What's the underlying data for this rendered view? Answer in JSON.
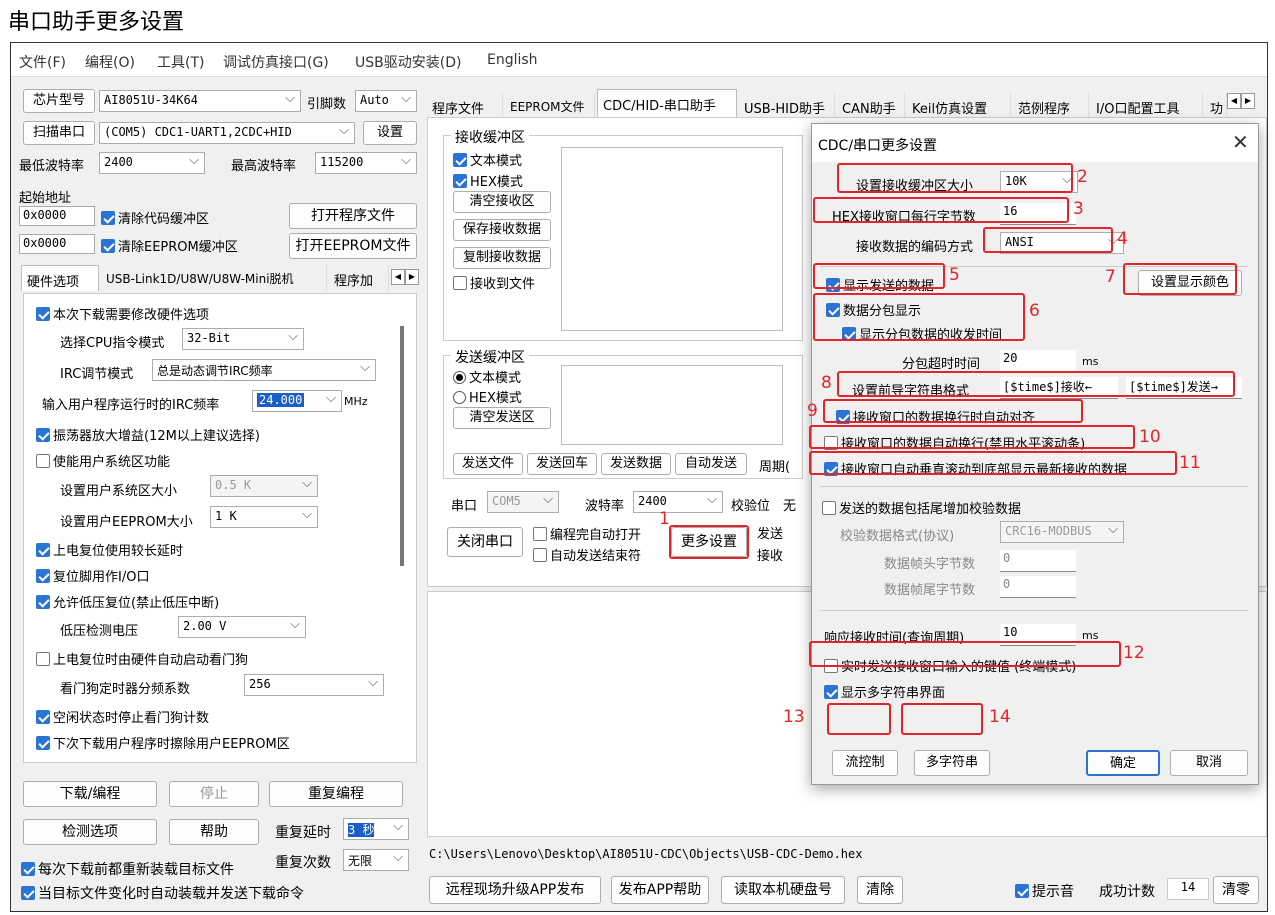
{
  "doc_title": "串口助手更多设置",
  "menu": [
    "文件(F)",
    "编程(O)",
    "工具(T)",
    "调试仿真接口(G)",
    "USB驱动安装(D)",
    "English"
  ],
  "left": {
    "chip_label": "芯片型号",
    "chip_value": "AI8051U-34K64",
    "pins_label": "引脚数",
    "pins_value": "Auto",
    "scan_button": "扫描串口",
    "port_value": "(COM5) CDC1-UART1,2CDC+HID",
    "settings_button": "设置",
    "min_baud_label": "最低波特率",
    "min_baud_value": "2400",
    "max_baud_label": "最高波特率",
    "max_baud_value": "115200",
    "start_addr_label": "起始地址",
    "addr1": "0x0000",
    "clear_code": "清除代码缓冲区",
    "open_prog": "打开程序文件",
    "addr2": "0x0000",
    "clear_eeprom": "清除EEPROM缓冲区",
    "open_eeprom": "打开EEPROM文件",
    "tabs": [
      "硬件选项",
      "USB-Link1D/U8W/U8W-Mini脱机",
      "程序加"
    ],
    "hw": {
      "modify": "本次下载需要修改硬件选项",
      "cpu_label": "选择CPU指令模式",
      "cpu_value": "32-Bit",
      "irc_label": "IRC调节模式",
      "irc_value": "总是动态调节IRC频率",
      "freq_label": "输入用户程序运行时的IRC频率",
      "freq_value": "24.000",
      "freq_unit": "MHz",
      "osc": "振荡器放大增益(12M以上建议选择)",
      "user_sys": "使能用户系统区功能",
      "sys_size_label": "设置用户系统区大小",
      "sys_size_value": "0.5 K",
      "eeprom_size_label": "设置用户EEPROM大小",
      "eeprom_size_value": "1  K",
      "long_delay": "上电复位使用较长延时",
      "reset_io": "复位脚用作I/O口",
      "lvr": "允许低压复位(禁止低压中断)",
      "lv_label": "低压检测电压",
      "lv_value": "2.00 V",
      "wdt_auto": "上电复位时由硬件自动启动看门狗",
      "wdt_div_label": "看门狗定时器分频系数",
      "wdt_div_value": "256",
      "idle_wdt": "空闲状态时停止看门狗计数",
      "erase_eeprom": "下次下载用户程序时擦除用户EEPROM区"
    },
    "download": "下载/编程",
    "stop": "停止",
    "reprogram": "重复编程",
    "check": "检测选项",
    "help": "帮助",
    "repeat_delay_label": "重复延时",
    "repeat_delay_value": "3 秒",
    "repeat_count_label": "重复次数",
    "repeat_count_value": "无限",
    "reload_each": "每次下载前都重新装载目标文件",
    "auto_reload": "当目标文件变化时自动装载并发送下载命令"
  },
  "right": {
    "tabs": [
      "程序文件",
      "EEPROM文件",
      "CDC/HID-串口助手",
      "USB-HID助手",
      "CAN助手",
      "Keil仿真设置",
      "范例程序",
      "I/O口配置工具",
      "功"
    ],
    "recv_group": "接收缓冲区",
    "text_mode": "文本模式",
    "hex_mode": "HEX模式",
    "clear_recv": "清空接收区",
    "save_recv": "保存接收数据",
    "copy_recv": "复制接收数据",
    "recv_file": "接收到文件",
    "send_group": "发送缓冲区",
    "send_text": "文本模式",
    "send_hex": "HEX模式",
    "clear_send": "清空发送区",
    "send_file": "发送文件",
    "send_cr": "发送回车",
    "send_data": "发送数据",
    "auto_send": "自动发送",
    "period": "周期(",
    "port_label": "串口",
    "port_value": "COM5",
    "baud_label": "波特率",
    "baud_value": "2400",
    "parity_label": "校验位",
    "parity_value": "无",
    "close_port": "关闭串口",
    "auto_open": "编程完自动打开",
    "auto_send_end": "自动发送结束符",
    "more_settings": "更多设置",
    "send_lbl": "发送",
    "recv_lbl": "接收",
    "path": "C:\\Users\\Lenovo\\Desktop\\AI8051U-CDC\\Objects\\USB-CDC-Demo.hex",
    "remote_app": "远程现场升级APP发布",
    "app_help": "发布APP帮助",
    "read_disk": "读取本机硬盘号",
    "clear": "清除",
    "beep": "提示音",
    "success_label": "成功计数",
    "success_value": "14",
    "reset_count": "清零"
  },
  "dialog": {
    "title": "CDC/串口更多设置",
    "recv_buf_label": "设置接收缓冲区大小",
    "recv_buf_value": "10K",
    "hex_bytes_label": "HEX接收窗口每行字节数",
    "hex_bytes_value": "16",
    "encoding_label": "接收数据的编码方式",
    "encoding_value": "ANSI",
    "show_sent": "显示发送的数据",
    "set_color": "设置显示颜色",
    "packet_show": "数据分包显示",
    "packet_time": "显示分包数据的收发时间",
    "timeout_label": "分包超时时间",
    "timeout_value": "20",
    "timeout_unit": "ms",
    "prefix_label": "设置前导字符串格式",
    "prefix_recv": "[$time$]接收←",
    "prefix_send": "[$time$]发送→",
    "align": "接收窗口的数据换行时自动对齐",
    "wrap": "接收窗口的数据自动换行(禁用水平滚动条)",
    "autoscroll": "接收窗口自动垂直滚动到底部显示最新接收的数据",
    "checksum": "发送的数据包括尾增加校验数据",
    "checksum_fmt_label": "校验数据格式(协议)",
    "checksum_fmt_value": "CRC16-MODBUS",
    "head_label": "数据帧头字节数",
    "head_value": "0",
    "tail_label": "数据帧尾字节数",
    "tail_value": "0",
    "resp_label": "响应接收时间(查询周期)",
    "resp_value": "10",
    "resp_unit": "ms",
    "terminal": "实时发送接收窗口输入的键值 (终端模式)",
    "multi_ui": "显示多字符串界面",
    "flow": "流控制",
    "multi": "多字符串",
    "ok": "确定",
    "cancel": "取消"
  },
  "markers": [
    "1",
    "2",
    "3",
    "4",
    "5",
    "6",
    "7",
    "8",
    "9",
    "10",
    "11",
    "12",
    "13",
    "14"
  ],
  "colors": {
    "highlight": "#e3242b",
    "checkbox": "#2a74d4"
  }
}
